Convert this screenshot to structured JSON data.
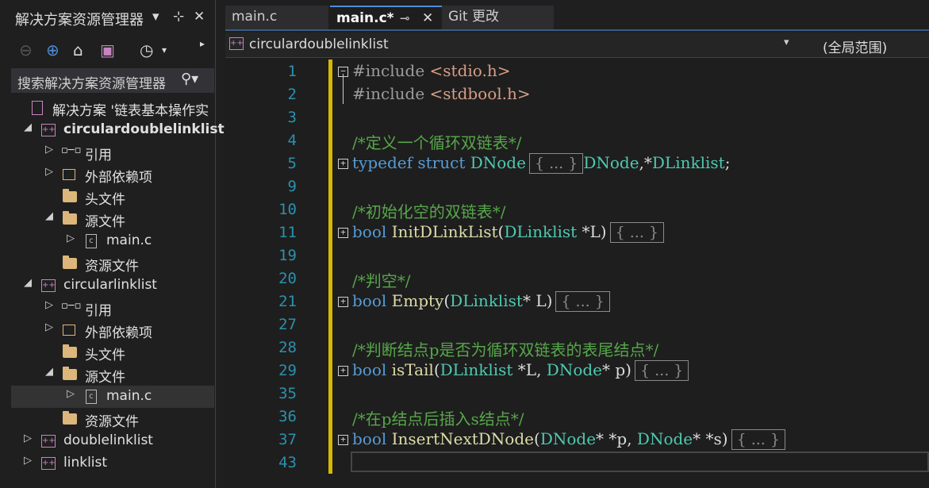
{
  "sidebar": {
    "title": "解决方案资源管理器",
    "controls": {
      "dropdown": "▾",
      "pin": "⊹",
      "close": "✕"
    },
    "search_placeholder": "搜索解决方案资源管理器",
    "solution_label": "解决方案 '链表基本操作实",
    "items": [
      {
        "label": "circulardoublelinklist",
        "expander": "◢",
        "icon": "project-icon",
        "bold": true
      },
      {
        "label": "引用",
        "expander": "▷",
        "icon": "references-icon"
      },
      {
        "label": "外部依赖项",
        "expander": "▷",
        "icon": "external-deps-icon"
      },
      {
        "label": "头文件",
        "expander": "",
        "icon": "filter-folder-icon"
      },
      {
        "label": "源文件",
        "expander": "◢",
        "icon": "filter-folder-icon"
      },
      {
        "label": "main.c",
        "expander": "▷",
        "icon": "c-file-icon"
      },
      {
        "label": "资源文件",
        "expander": "",
        "icon": "filter-folder-icon"
      },
      {
        "label": "circularlinklist",
        "expander": "◢",
        "icon": "project-icon"
      },
      {
        "label": "引用",
        "expander": "▷",
        "icon": "references-icon"
      },
      {
        "label": "外部依赖项",
        "expander": "▷",
        "icon": "external-deps-icon"
      },
      {
        "label": "头文件",
        "expander": "",
        "icon": "filter-folder-icon"
      },
      {
        "label": "源文件",
        "expander": "◢",
        "icon": "filter-folder-icon"
      },
      {
        "label": "main.c",
        "expander": "▷",
        "icon": "c-file-icon",
        "selected": true
      },
      {
        "label": "资源文件",
        "expander": "",
        "icon": "filter-folder-icon"
      },
      {
        "label": "doublelinklist",
        "expander": "▷",
        "icon": "project-icon"
      },
      {
        "label": "linklist",
        "expander": "▷",
        "icon": "project-icon"
      }
    ]
  },
  "tabs": [
    {
      "label": "main.c"
    },
    {
      "label": "main.c*",
      "active": true
    },
    {
      "label": "Git 更改"
    }
  ],
  "navbar": {
    "project": "circulardoublelinklist",
    "scope": "(全局范围)"
  },
  "editor": {
    "lines": [
      {
        "num": "1",
        "html": "<span class=\"pp\">#include</span> <span class=\"st\">&lt;stdio.h&gt;</span>"
      },
      {
        "num": "2",
        "html": "<span class=\"pp\">#include</span> <span class=\"st\">&lt;stdbool.h&gt;</span>"
      },
      {
        "num": "3",
        "html": ""
      },
      {
        "num": "4",
        "html": "<span class=\"cm\">/*定义一个循环双链表*/</span>"
      },
      {
        "num": "5",
        "html": "<span class=\"kw\">typedef</span> <span class=\"kw\">struct</span> <span class=\"ty\">DNode</span><span class=\"coll\">{ ... }</span><span class=\"ty\">DNode</span>,*<span class=\"ty\">DLinklist</span>;"
      },
      {
        "num": "9",
        "html": ""
      },
      {
        "num": "10",
        "html": "<span class=\"cm\">/*初始化空的双链表*/</span>"
      },
      {
        "num": "11",
        "html": "<span class=\"kw\">bool</span> <span class=\"fn\">InitDLinkList</span>(<span class=\"ty\">DLinklist</span> *L)<span class=\"coll\">{ ... }</span>"
      },
      {
        "num": "19",
        "html": ""
      },
      {
        "num": "20",
        "html": "<span class=\"cm\">/*判空*/</span>"
      },
      {
        "num": "21",
        "html": "<span class=\"kw\">bool</span> <span class=\"fn\">Empty</span>(<span class=\"ty\">DLinklist</span>* L)<span class=\"coll\">{ ... }</span>"
      },
      {
        "num": "27",
        "html": ""
      },
      {
        "num": "28",
        "html": "<span class=\"cm\">/*判断结点p是否为循环双链表的表尾结点*/</span>"
      },
      {
        "num": "29",
        "html": "<span class=\"kw\">bool</span> <span class=\"fn\">isTail</span>(<span class=\"ty\">DLinklist</span> *L, <span class=\"ty\">DNode</span>* p)<span class=\"coll\">{ ... }</span>"
      },
      {
        "num": "35",
        "html": ""
      },
      {
        "num": "36",
        "html": "<span class=\"cm\">/*在p结点后插入s结点*/</span>"
      },
      {
        "num": "37",
        "html": "<span class=\"kw\">bool</span> <span class=\"fn\">InsertNextDNode</span>(<span class=\"ty\">DNode</span>* *p, <span class=\"ty\">DNode</span>* *s)<span class=\"coll\">{ ... }</span>"
      },
      {
        "num": "43",
        "html": ""
      }
    ]
  }
}
